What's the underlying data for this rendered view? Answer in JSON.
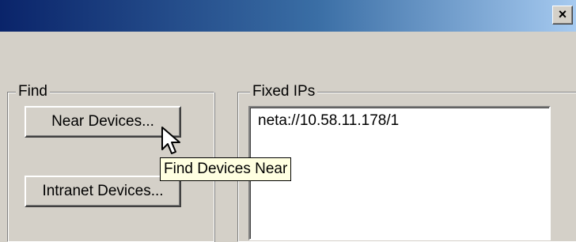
{
  "window": {
    "title": "",
    "close_label": "×",
    "colors": {
      "title_gradient_start": "#0a246a",
      "title_gradient_end": "#a6caf0",
      "face": "#d4d0c8",
      "tooltip_bg": "#ffffe1"
    }
  },
  "find_group": {
    "label": "Find",
    "near_devices_label": "Near Devices...",
    "intranet_devices_label": "Intranet Devices..."
  },
  "fixed_ips_group": {
    "label": "Fixed IPs",
    "items": [
      "neta://10.58.11.178/1"
    ]
  },
  "tooltip": {
    "text": "Find Devices Near"
  },
  "icons": {
    "close": "close-icon",
    "cursor": "mouse-pointer-icon"
  }
}
